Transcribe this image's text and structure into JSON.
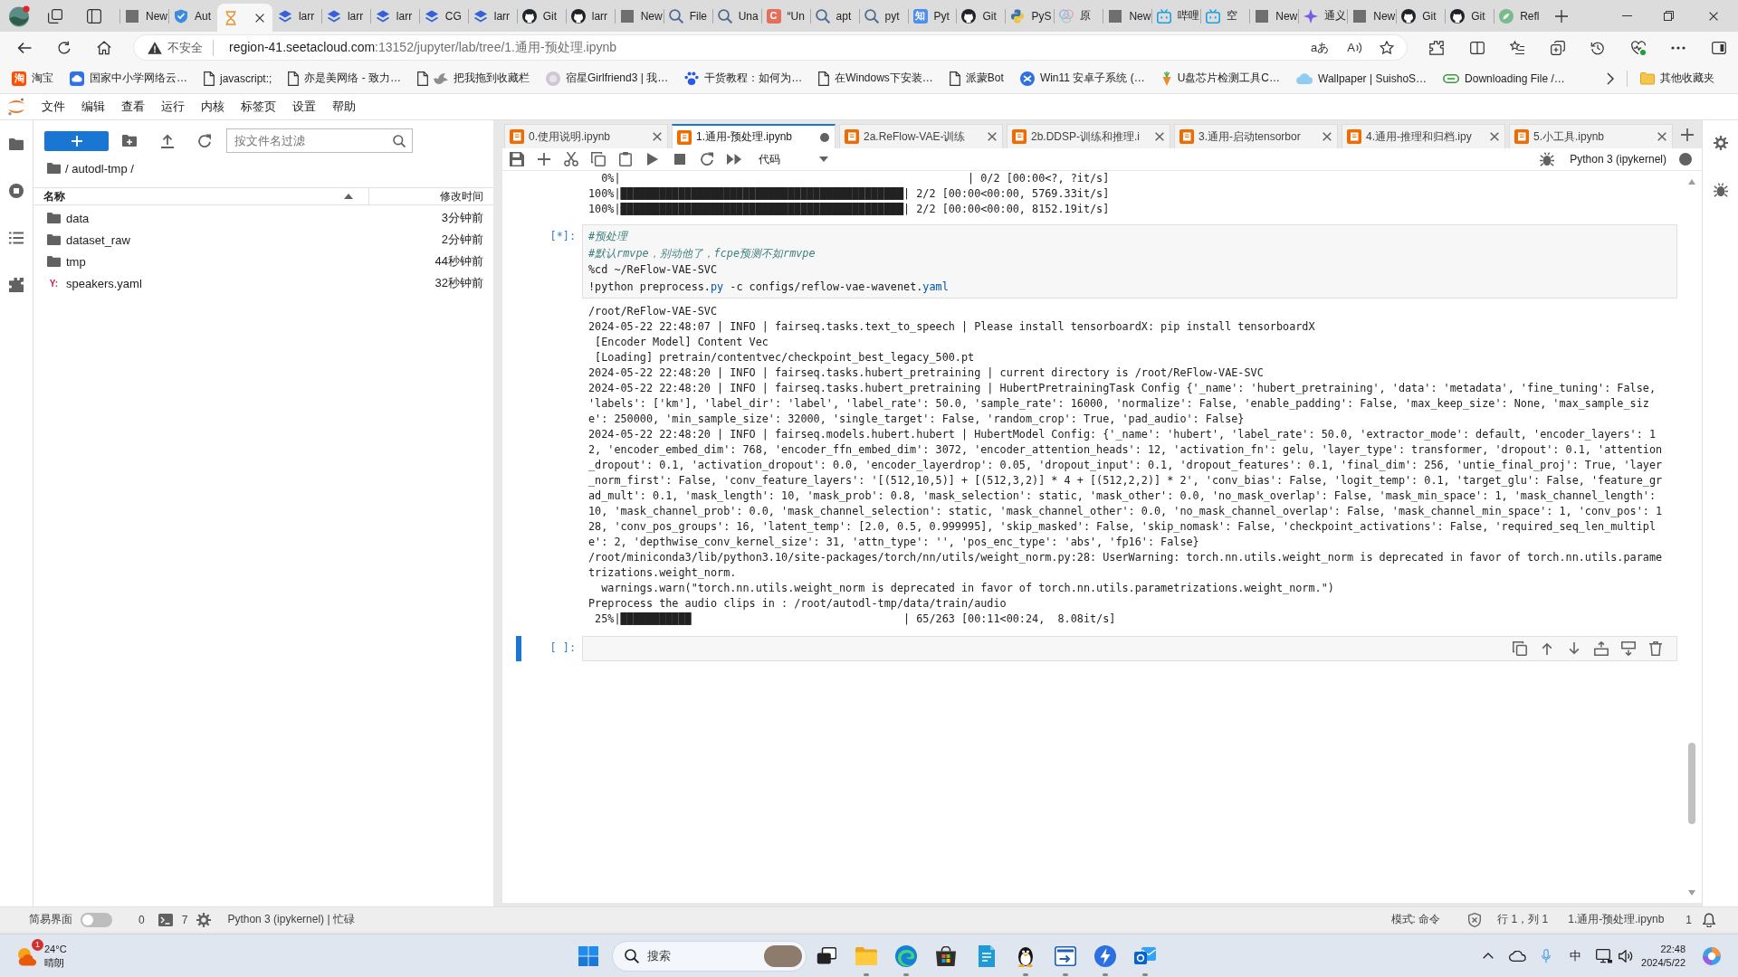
{
  "browser": {
    "tabs": [
      {
        "title": "New",
        "kind": "square",
        "selected": false
      },
      {
        "title": "Aut",
        "kind": "shield",
        "selected": false
      },
      {
        "kind": "hourglass",
        "selected": true
      },
      {
        "title": "larr",
        "kind": "layers",
        "selected": false
      },
      {
        "title": "larr",
        "kind": "layers",
        "selected": false
      },
      {
        "title": "larr",
        "kind": "layers",
        "selected": false
      },
      {
        "title": "CG",
        "kind": "layers",
        "selected": false
      },
      {
        "title": "larr",
        "kind": "layers",
        "selected": false
      },
      {
        "title": "Git",
        "kind": "cat",
        "selected": false
      },
      {
        "title": "larr",
        "kind": "cat",
        "selected": false
      },
      {
        "title": "New",
        "kind": "square",
        "selected": false
      },
      {
        "title": "File",
        "kind": "magnifier",
        "selected": false
      },
      {
        "title": "Una",
        "kind": "magnifier",
        "selected": false
      },
      {
        "title": "“Un",
        "kind": "tile",
        "glyph": "C",
        "color": "#e4705c",
        "selected": false
      },
      {
        "title": "apt",
        "kind": "magnifier",
        "selected": false
      },
      {
        "title": "pyt",
        "kind": "magnifier",
        "selected": false
      },
      {
        "title": "Pyt",
        "kind": "tile",
        "glyph": "知",
        "color": "#4d8ef0",
        "selected": false
      },
      {
        "title": "Git",
        "kind": "cat",
        "selected": false
      },
      {
        "title": "PyS",
        "kind": "twotone",
        "selected": false
      },
      {
        "title": "原",
        "kind": "rings",
        "selected": false
      },
      {
        "title": "New",
        "kind": "square",
        "selected": false
      },
      {
        "title": "哔哩",
        "kind": "tv",
        "selected": false
      },
      {
        "title": "空",
        "kind": "tv",
        "selected": false
      },
      {
        "title": "New",
        "kind": "square",
        "selected": false
      },
      {
        "title": "通义",
        "kind": "star",
        "selected": false
      },
      {
        "title": "New",
        "kind": "square",
        "selected": false
      },
      {
        "title": "Git",
        "kind": "cat",
        "selected": false
      },
      {
        "title": "Git",
        "kind": "cat",
        "selected": false
      },
      {
        "title": "Refl",
        "kind": "blob",
        "selected": false
      }
    ],
    "address": {
      "security": "不安全",
      "host": "region-41.seetacloud.com",
      "path": ":13152/jupyter/lab/tree/1.通用-预处理.ipynb",
      "translate": "aあ",
      "read_aloud": "A"
    },
    "bookmarks": [
      {
        "label": "淘宝",
        "kind": "tile",
        "glyph": "淘",
        "color": "#ff5000"
      },
      {
        "label": "国家中小学网络云…",
        "kind": "cloudtile"
      },
      {
        "label": "javascript:;",
        "kind": "page"
      },
      {
        "label": "亦是美网络 - 致力…",
        "kind": "page"
      },
      {
        "label": "把我拖到收藏栏",
        "kind": "pagebird"
      },
      {
        "label": "宿星Girlfriend3 | 我…",
        "kind": "avatar"
      },
      {
        "label": "干货教程：如何为…",
        "kind": "paw"
      },
      {
        "label": "在Windows下安装…",
        "kind": "page"
      },
      {
        "label": "派蒙Bot",
        "kind": "page"
      },
      {
        "label": "Win11 安卓子系统 (…",
        "kind": "badge"
      },
      {
        "label": "U盘芯片检测工具C…",
        "kind": "carrot"
      },
      {
        "label": "Wallpaper | SuishoS…",
        "kind": "cloud"
      },
      {
        "label": "Downloading File /…",
        "kind": "pill"
      }
    ],
    "other_bookmarks": "其他收藏夹"
  },
  "jupyterlab": {
    "menu": [
      "文件",
      "编辑",
      "查看",
      "运行",
      "内核",
      "标签页",
      "设置",
      "帮助"
    ],
    "file_browser": {
      "filter_placeholder": "按文件名过滤",
      "path": "/ autodl-tmp /",
      "columns": [
        {
          "label": "名称",
          "sorted": true
        },
        {
          "label": "修改时间",
          "sorted": false
        }
      ],
      "items": [
        {
          "kind": "folder",
          "name": "data",
          "modified": "3分钟前"
        },
        {
          "kind": "folder",
          "name": "dataset_raw",
          "modified": "2分钟前"
        },
        {
          "kind": "folder",
          "name": "tmp",
          "modified": "44秒钟前"
        },
        {
          "kind": "file",
          "glyph": "Y:",
          "name": "speakers.yaml",
          "modified": "32秒钟前"
        }
      ]
    },
    "notebook": {
      "tabs": [
        {
          "label": "0.使用说明.ipynb",
          "selected": false,
          "dirty": false
        },
        {
          "label": "1.通用-预处理.ipynb",
          "selected": true,
          "dirty": true
        },
        {
          "label": "2a.ReFlow-VAE-训练",
          "selected": false,
          "dirty": false
        },
        {
          "label": "2b.DDSP-训练和推理.i",
          "selected": false,
          "dirty": false
        },
        {
          "label": "3.通用-启动tensorbor",
          "selected": false,
          "dirty": false
        },
        {
          "label": "4.通用-推理和归档.ipy",
          "selected": false,
          "dirty": false
        },
        {
          "label": "5.小工具.ipynb",
          "selected": false,
          "dirty": false
        }
      ],
      "toolbar": {
        "cell_type": "代码",
        "kernel": "Python 3 (ipykernel)",
        "kernel_busy": true
      },
      "cells": [
        {
          "kind": "output",
          "lines": [
            "  0%|                                                      | 0/2 [00:00<?, ?it/s]",
            "100%|████████████████████████████████████████████| 2/2 [00:00<00:00, 5769.33it/s]",
            "100%|████████████████████████████████████████████| 2/2 [00:00<00:00, 8152.19it/s]"
          ]
        },
        {
          "kind": "code",
          "prompt": "[*]:",
          "active": false,
          "source": [
            [
              {
                "kind": "comment",
                "text": "#预处理"
              }
            ],
            [
              {
                "kind": "comment",
                "text": "#默认rmvpe，别动他了，fcpe预测不如rmvpe"
              }
            ],
            [
              {
                "kind": "plain",
                "text": "%cd ~/ReFlow-VAE-SVC"
              }
            ],
            [
              {
                "kind": "plain",
                "text": "!python preprocess."
              },
              {
                "kind": "property",
                "text": "py"
              },
              {
                "kind": "plain",
                "text": " -c configs/reflow-vae-wavenet."
              },
              {
                "kind": "property",
                "text": "yaml"
              }
            ]
          ],
          "outputs": [
            "/root/ReFlow-VAE-SVC",
            "2024-05-22 22:48:07 | INFO | fairseq.tasks.text_to_speech | Please install tensorboardX: pip install tensorboardX",
            " [Encoder Model] Content Vec",
            " [Loading] pretrain/contentvec/checkpoint_best_legacy_500.pt",
            "2024-05-22 22:48:20 | INFO | fairseq.tasks.hubert_pretraining | current directory is /root/ReFlow-VAE-SVC",
            "2024-05-22 22:48:20 | INFO | fairseq.tasks.hubert_pretraining | HubertPretrainingTask Config {'_name': 'hubert_pretraining', 'data': 'metadata', 'fine_tuning': False,",
            "'labels': ['km'], 'label_dir': 'label', 'label_rate': 50.0, 'sample_rate': 16000, 'normalize': False, 'enable_padding': False, 'max_keep_size': None, 'max_sample_siz",
            "e': 250000, 'min_sample_size': 32000, 'single_target': False, 'random_crop': True, 'pad_audio': False}",
            "2024-05-22 22:48:20 | INFO | fairseq.models.hubert.hubert | HubertModel Config: {'_name': 'hubert', 'label_rate': 50.0, 'extractor_mode': default, 'encoder_layers': 1",
            "2, 'encoder_embed_dim': 768, 'encoder_ffn_embed_dim': 3072, 'encoder_attention_heads': 12, 'activation_fn': gelu, 'layer_type': transformer, 'dropout': 0.1, 'attention",
            "_dropout': 0.1, 'activation_dropout': 0.0, 'encoder_layerdrop': 0.05, 'dropout_input': 0.1, 'dropout_features': 0.1, 'final_dim': 256, 'untie_final_proj': True, 'layer",
            "_norm_first': False, 'conv_feature_layers': '[(512,10,5)] + [(512,3,2)] * 4 + [(512,2,2)] * 2', 'conv_bias': False, 'logit_temp': 0.1, 'target_glu': False, 'feature_gr",
            "ad_mult': 0.1, 'mask_length': 10, 'mask_prob': 0.8, 'mask_selection': static, 'mask_other': 0.0, 'no_mask_overlap': False, 'mask_min_space': 1, 'mask_channel_length':",
            "10, 'mask_channel_prob': 0.0, 'mask_channel_selection': static, 'mask_channel_other': 0.0, 'no_mask_channel_overlap': False, 'mask_channel_min_space': 1, 'conv_pos': 1",
            "28, 'conv_pos_groups': 16, 'latent_temp': [2.0, 0.5, 0.999995], 'skip_masked': False, 'skip_nomask': False, 'checkpoint_activations': False, 'required_seq_len_multipl",
            "e': 2, 'depthwise_conv_kernel_size': 31, 'attn_type': '', 'pos_enc_type': 'abs', 'fp16': False}",
            "/root/miniconda3/lib/python3.10/site-packages/torch/nn/utils/weight_norm.py:28: UserWarning: torch.nn.utils.weight_norm is deprecated in favor of torch.nn.utils.parame",
            "trizations.weight_norm.",
            "  warnings.warn(\"torch.nn.utils.weight_norm is deprecated in favor of torch.nn.utils.parametrizations.weight_norm.\")",
            "Preprocess the audio clips in : /root/autodl-tmp/data/train/audio",
            " 25%|███████████                                 | 65/263 [00:11<00:24,  8.08it/s]"
          ]
        },
        {
          "kind": "code",
          "prompt": "[ ]:",
          "active": true
        }
      ]
    },
    "status_bar": {
      "simple_interface": {
        "label": "简易界面",
        "on": false
      },
      "terminals": "0",
      "kernels": "7",
      "kernel_status": "Python 3 (ipykernel) | 忙碌",
      "mode": "模式: 命令",
      "cursor": "行 1，列 1",
      "file": "1.通用-预处理.ipynb",
      "notifications": "1"
    }
  },
  "taskbar": {
    "weather": {
      "badge": "1",
      "temperature": "24°C",
      "condition": "晴朗"
    },
    "search_placeholder": "搜索",
    "apps": [
      {
        "kind": "taskview",
        "running": false
      },
      {
        "kind": "folder",
        "running": true
      },
      {
        "kind": "browser",
        "running": true
      },
      {
        "kind": "store",
        "running": false
      },
      {
        "kind": "book",
        "running": false
      },
      {
        "kind": "penguin",
        "running": true
      },
      {
        "kind": "remote",
        "running": true
      },
      {
        "kind": "lightning",
        "running": true
      },
      {
        "kind": "mail",
        "running": true
      }
    ],
    "tray": {
      "input_method": "中",
      "time": "22:48",
      "date": "2024/5/22"
    }
  }
}
